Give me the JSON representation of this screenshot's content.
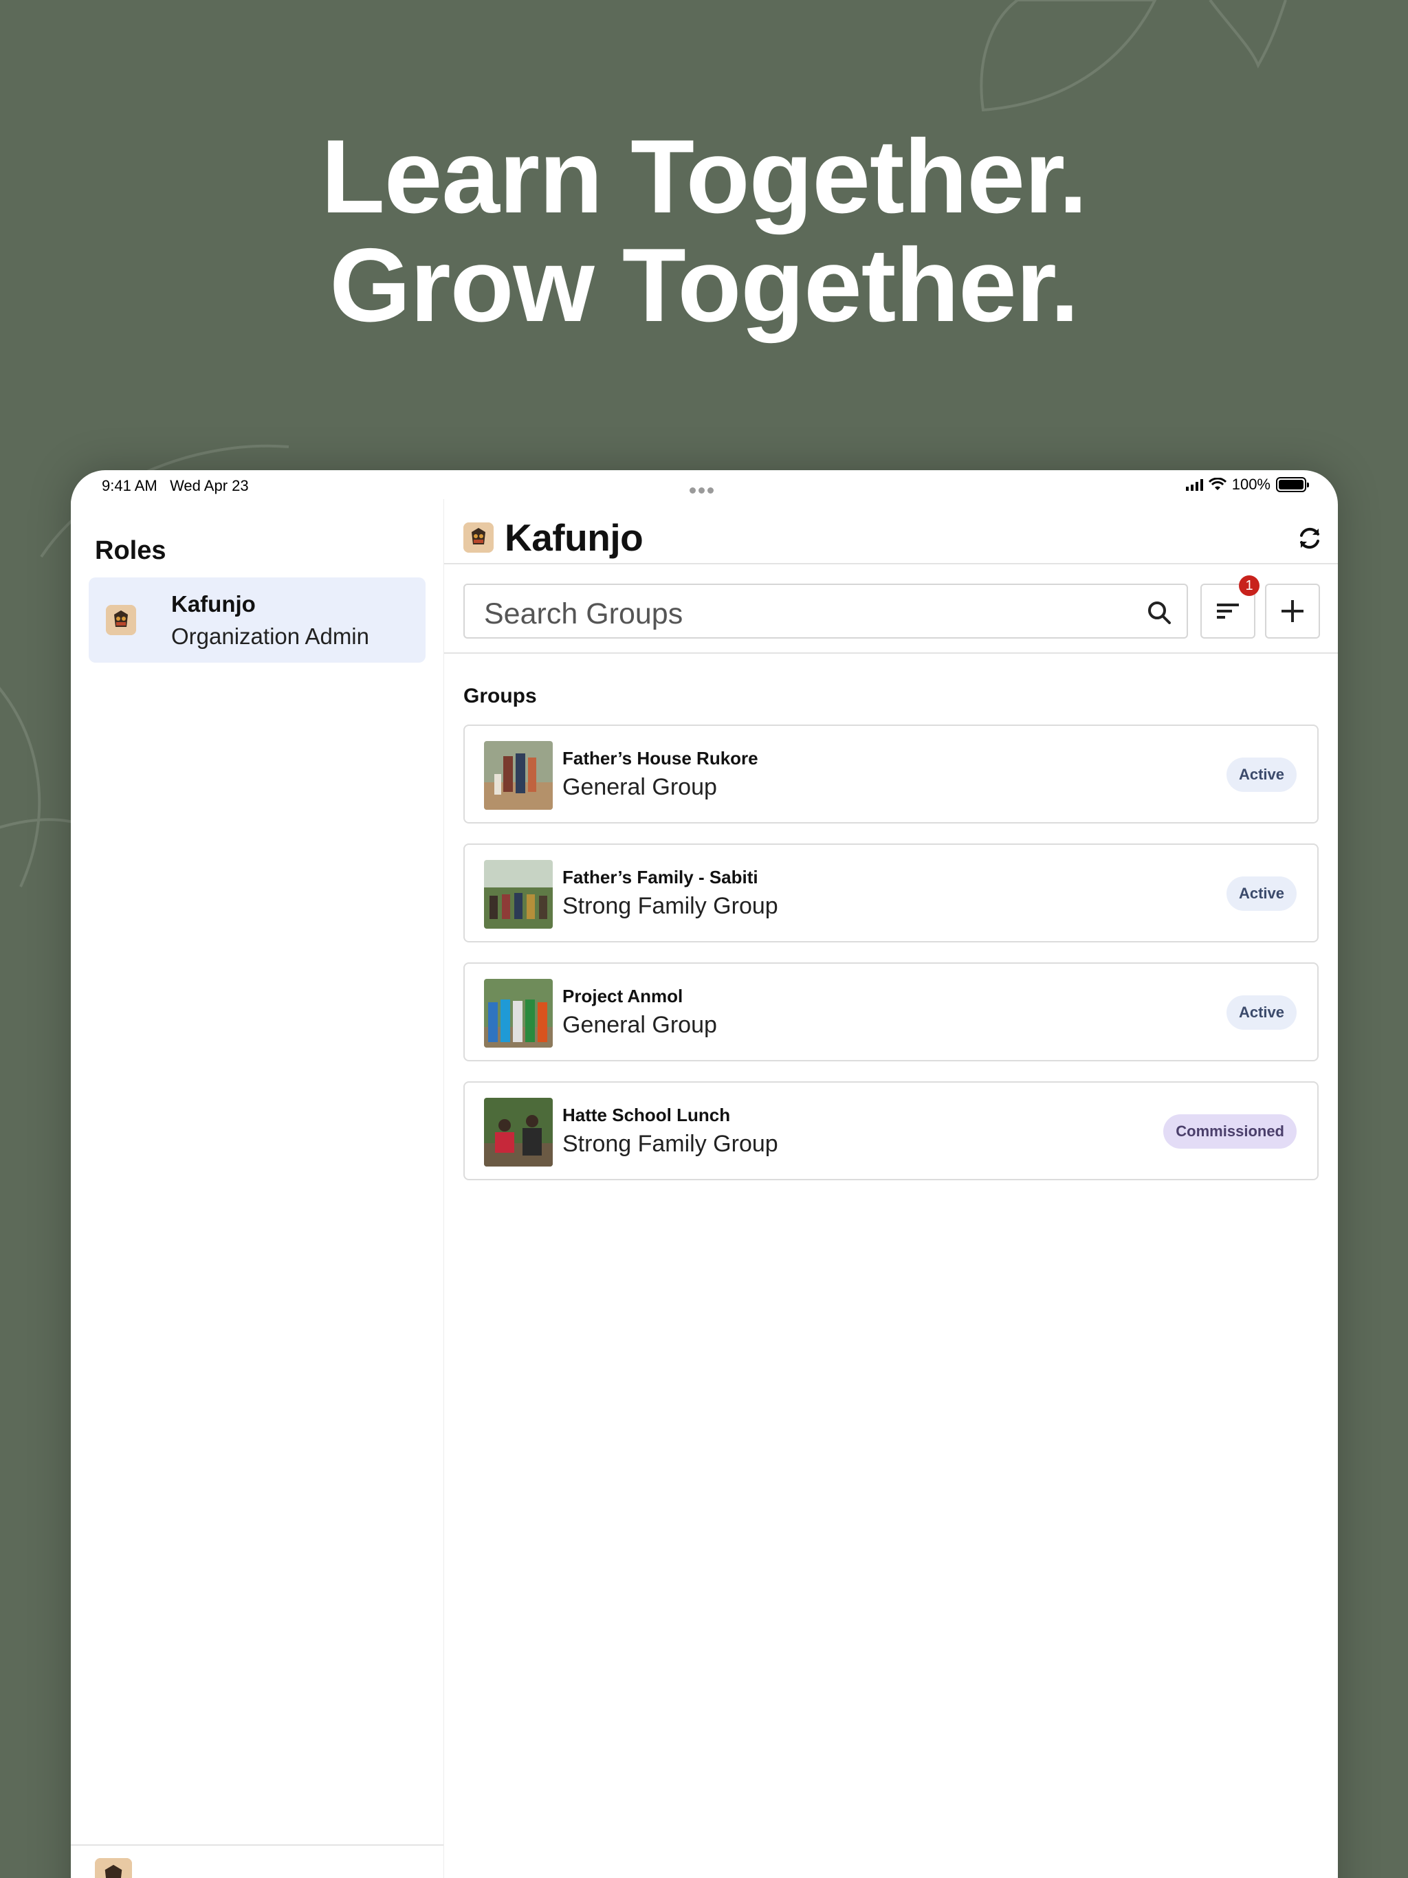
{
  "headline": {
    "line1": "Learn Together.",
    "line2": "Grow Together."
  },
  "status_bar": {
    "time": "9:41 AM",
    "date": "Wed Apr 23",
    "battery": "100%"
  },
  "sidebar": {
    "title": "Roles",
    "roles": [
      {
        "name": "Kafunjo",
        "role": "Organization Admin",
        "selected": true
      }
    ]
  },
  "header": {
    "title": "Kafunjo",
    "icons": [
      "refresh-icon",
      "bell-icon"
    ]
  },
  "search": {
    "placeholder": "Search Groups",
    "filter_badge": "1"
  },
  "groups": {
    "label": "Groups",
    "items": [
      {
        "title": "Father’s House Rukore",
        "type": "General Group",
        "status": "Active"
      },
      {
        "title": "Father’s Family - Sabiti",
        "type": "Strong Family Group",
        "status": "Active"
      },
      {
        "title": "Project Anmol",
        "type": "General Group",
        "status": "Active"
      },
      {
        "title": "Hatte School Lunch",
        "type": "Strong Family Group",
        "status": "Commissioned"
      }
    ]
  },
  "colors": {
    "background": "#5d6a59",
    "selected_role_bg": "#eaeffb",
    "active_pill_bg": "#e9eef9",
    "active_pill_text": "#3b4a6b",
    "commissioned_pill_bg": "#e3dcf6",
    "commissioned_pill_text": "#4b3f6b",
    "badge": "#c8221c"
  }
}
